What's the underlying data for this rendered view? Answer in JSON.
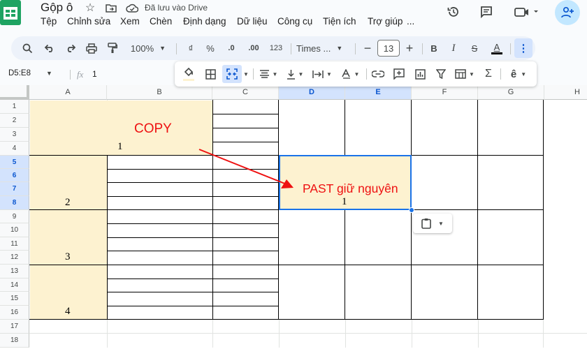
{
  "title": "Gộp ô",
  "save_status": "Đã lưu vào Drive",
  "menu": [
    "Tệp",
    "Chỉnh sửa",
    "Xem",
    "Chèn",
    "Định dạng",
    "Dữ liệu",
    "Công cụ",
    "Tiện ích",
    "Trợ giúp",
    "..."
  ],
  "toolbar": {
    "zoom": "100%",
    "currency": "₫",
    "percent": "%",
    "dec_decrease": ".0",
    "dec_increase": ".00",
    "number_format": "123",
    "font": "Times ...",
    "font_size": "13",
    "bold": "B",
    "italic": "I",
    "strike": "S",
    "textcolor": "A"
  },
  "formula": {
    "range": "D5:E8",
    "fx": "fx",
    "value": "1"
  },
  "columns": [
    "A",
    "B",
    "C",
    "D",
    "E",
    "F",
    "G",
    "H"
  ],
  "rows": [
    "1",
    "2",
    "3",
    "4",
    "5",
    "6",
    "7",
    "8",
    "9",
    "10",
    "11",
    "12",
    "13",
    "14",
    "15",
    "16",
    "17",
    "18"
  ],
  "cells": {
    "a1": "1",
    "a5": "2",
    "a9": "3",
    "a13": "4",
    "d5": "1"
  },
  "annotations": {
    "copy": "COPY",
    "paste": "PAST giữ nguyên"
  },
  "colors": {
    "accent": "#0b57d0",
    "fill": "#fdf2d0",
    "annotation": "#e11111",
    "sheets_green": "#1ea362"
  }
}
